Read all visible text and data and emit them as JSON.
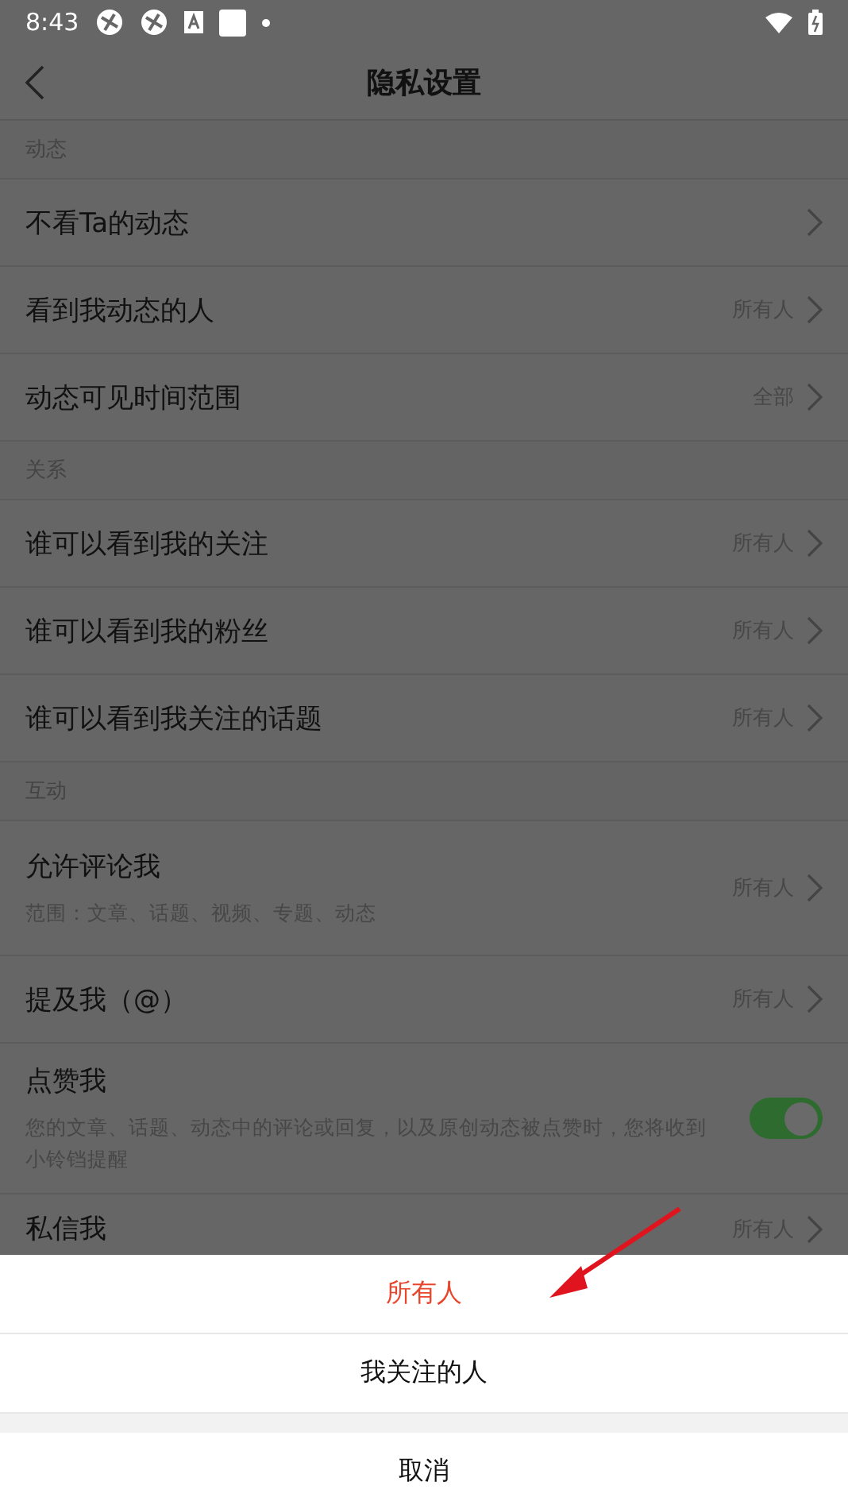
{
  "status_bar": {
    "time": "8:43"
  },
  "header": {
    "title": "隐私设置"
  },
  "sections": [
    {
      "title": "动态",
      "rows": [
        {
          "kind": "link",
          "label": "不看Ta的动态"
        },
        {
          "kind": "link",
          "label": "看到我动态的人",
          "value": "所有人"
        },
        {
          "kind": "link",
          "label": "动态可见时间范围",
          "value": "全部"
        }
      ]
    },
    {
      "title": "关系",
      "rows": [
        {
          "kind": "link",
          "label": "谁可以看到我的关注",
          "value": "所有人"
        },
        {
          "kind": "link",
          "label": "谁可以看到我的粉丝",
          "value": "所有人"
        },
        {
          "kind": "link",
          "label": "谁可以看到我关注的话题",
          "value": "所有人"
        }
      ]
    },
    {
      "title": "互动",
      "rows": [
        {
          "kind": "link",
          "label": "允许评论我",
          "description": "范围：文章、话题、视频、专题、动态",
          "value": "所有人"
        },
        {
          "kind": "link",
          "label": "提及我（@）",
          "value": "所有人"
        },
        {
          "kind": "toggle",
          "label": "点赞我",
          "description": "您的文章、话题、动态中的评论或回复，以及原创动态被点赞时，您将收到小铃铛提醒",
          "on": true
        },
        {
          "kind": "link",
          "label": "私信我",
          "value": "所有人"
        }
      ]
    }
  ],
  "sheet": {
    "options": [
      {
        "label": "所有人",
        "selected": true
      },
      {
        "label": "我关注的人",
        "selected": false
      }
    ],
    "cancel": "取消"
  }
}
